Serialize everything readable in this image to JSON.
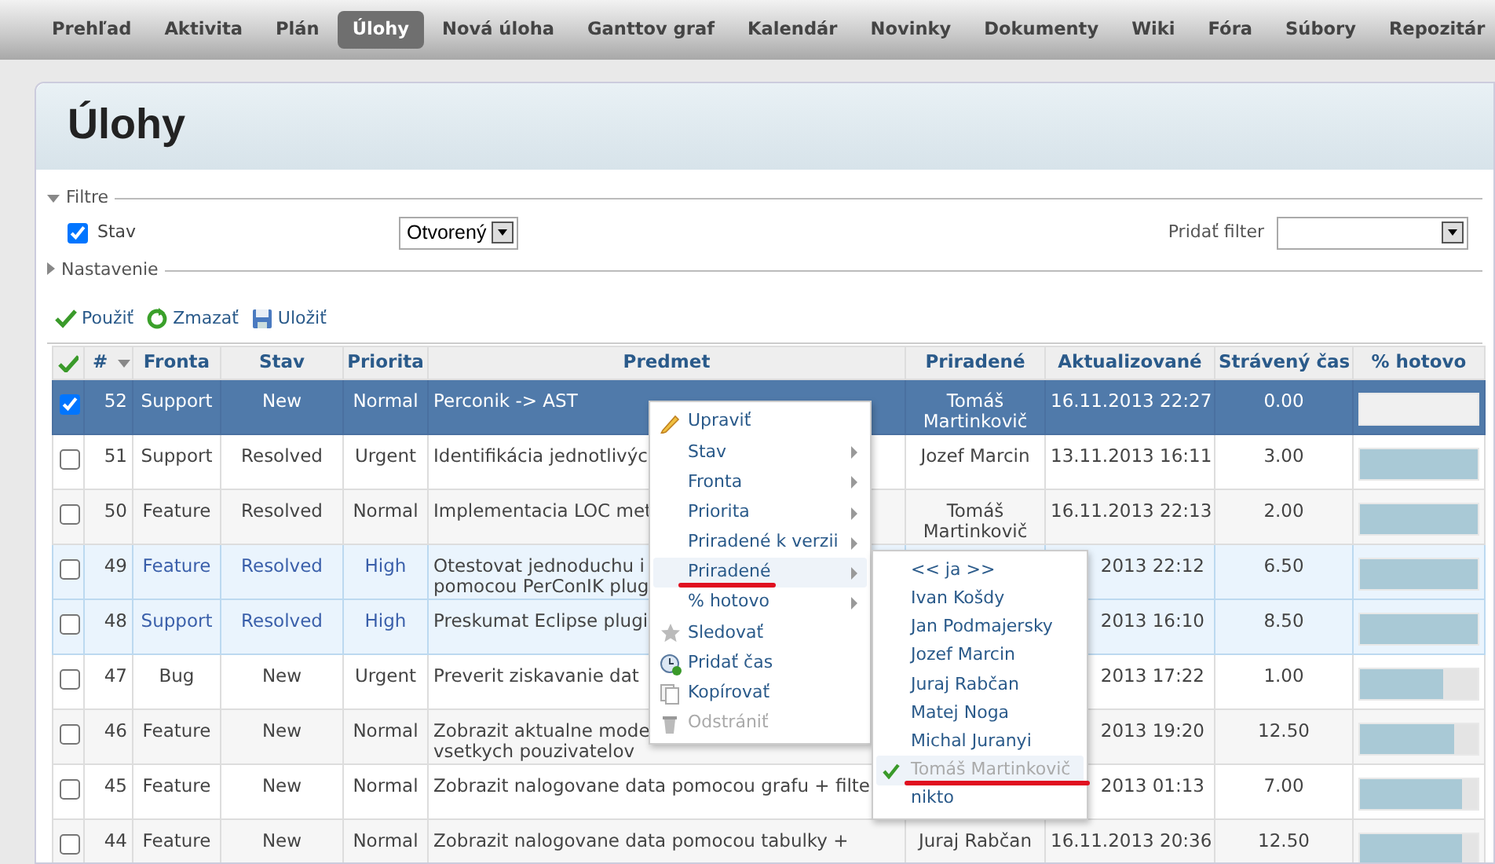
{
  "nav": [
    {
      "label": "Prehľad",
      "selected": false
    },
    {
      "label": "Aktivita",
      "selected": false
    },
    {
      "label": "Plán",
      "selected": false
    },
    {
      "label": "Úlohy",
      "selected": true
    },
    {
      "label": "Nová úloha",
      "selected": false
    },
    {
      "label": "Ganttov graf",
      "selected": false
    },
    {
      "label": "Kalendár",
      "selected": false
    },
    {
      "label": "Novinky",
      "selected": false
    },
    {
      "label": "Dokumenty",
      "selected": false
    },
    {
      "label": "Wiki",
      "selected": false
    },
    {
      "label": "Fóra",
      "selected": false
    },
    {
      "label": "Súbory",
      "selected": false
    },
    {
      "label": "Repozitár",
      "selected": false
    }
  ],
  "page_title": "Úlohy",
  "filters": {
    "legend": "Filtre",
    "expanded": true,
    "field": {
      "label": "Stav",
      "checked": true,
      "value": "Otvorený"
    },
    "add_label": "Pridať filter"
  },
  "options": {
    "legend": "Nastavenie",
    "expanded": false
  },
  "actions": [
    {
      "kind": "apply",
      "label": "Použiť"
    },
    {
      "kind": "clear",
      "label": "Zmazať"
    },
    {
      "kind": "save",
      "label": "Uložiť"
    }
  ],
  "table": {
    "columns": [
      "#",
      "Fronta",
      "Stav",
      "Priorita",
      "Predmet",
      "Priradené",
      "Aktualizované",
      "Strávený čas",
      "% hotovo"
    ],
    "rows": [
      {
        "id": "52",
        "tracker": "Support",
        "status": "New",
        "priority": "Normal",
        "subject": [
          "Perconik -> AST"
        ],
        "assignee": [
          "Tomáš",
          "Martinkovič"
        ],
        "updated": "16.11.2013 22:27",
        "spent": "0.00",
        "level": 0,
        "selected": true,
        "highlighted": false
      },
      {
        "id": "51",
        "tracker": "Support",
        "status": "Resolved",
        "priority": "Urgent",
        "subject": [
          "Identifikácia jednotlivýc"
        ],
        "assignee": [
          "Jozef Marcin"
        ],
        "updated": "13.11.2013 16:11",
        "spent": "3.00",
        "level": 1,
        "selected": false,
        "highlighted": false
      },
      {
        "id": "50",
        "tracker": "Feature",
        "status": "Resolved",
        "priority": "Normal",
        "subject": [
          "Implementacia LOC met"
        ],
        "assignee": [
          "Tomáš",
          "Martinkovič"
        ],
        "updated": "16.11.2013 22:13",
        "spent": "2.00",
        "level": 1,
        "selected": false,
        "highlighted": false
      },
      {
        "id": "49",
        "tracker": "Feature",
        "status": "Resolved",
        "priority": "High",
        "subject": [
          "Otestovat jednoduchu i",
          "pomocou PerConIK plug"
        ],
        "updated": "2013 22:12",
        "spent": "6.50",
        "level": 1,
        "selected": false,
        "highlighted": true
      },
      {
        "id": "48",
        "tracker": "Support",
        "status": "Resolved",
        "priority": "High",
        "subject": [
          "Preskumat Eclipse plugi"
        ],
        "updated": "2013 16:10",
        "spent": "8.50",
        "level": 1,
        "selected": false,
        "highlighted": true
      },
      {
        "id": "47",
        "tracker": "Bug",
        "status": "New",
        "priority": "Urgent",
        "subject": [
          "Preverit ziskavanie dat"
        ],
        "updated": "2013 17:22",
        "spent": "1.00",
        "level": 0.7,
        "selected": false,
        "highlighted": false
      },
      {
        "id": "46",
        "tracker": "Feature",
        "status": "New",
        "priority": "Normal",
        "subject": [
          "Zobrazit aktualne mode",
          "vsetkych pouzivatelov"
        ],
        "updated": "2013 19:20",
        "spent": "12.50",
        "level": 0.8,
        "selected": false,
        "highlighted": false
      },
      {
        "id": "45",
        "tracker": "Feature",
        "status": "New",
        "priority": "Normal",
        "subject": [
          "Zobrazit nalogovane data pomocou grafu + filte"
        ],
        "updated": "2013 01:13",
        "spent": "7.00",
        "level": 0.86,
        "selected": false,
        "highlighted": false
      },
      {
        "id": "44",
        "tracker": "Feature",
        "status": "New",
        "priority": "Normal",
        "subject": [
          "Zobrazit nalogovane data pomocou tabulky +"
        ],
        "assignee": [
          "Juraj Rabčan"
        ],
        "updated": "16.11.2013 20:36",
        "spent": "12.50",
        "level": 0.86,
        "selected": false,
        "highlighted": false
      }
    ]
  },
  "context_menu": [
    {
      "kind": "edit",
      "label": "Upraviť",
      "selected": false,
      "disabled": false,
      "underlined": false
    },
    {
      "kind": "submenu",
      "label": "Stav",
      "selected": false,
      "disabled": false,
      "underlined": false
    },
    {
      "kind": "submenu",
      "label": "Fronta",
      "selected": false,
      "disabled": false,
      "underlined": false
    },
    {
      "kind": "submenu",
      "label": "Priorita",
      "selected": false,
      "disabled": false,
      "underlined": false
    },
    {
      "kind": "submenu",
      "label": "Priradené k verzii",
      "selected": false,
      "disabled": false,
      "underlined": false
    },
    {
      "kind": "submenu",
      "label": "Priradené",
      "selected": true,
      "disabled": false,
      "underlined": true
    },
    {
      "kind": "submenu",
      "label": "% hotovo",
      "selected": false,
      "disabled": false,
      "underlined": false
    },
    {
      "kind": "watch",
      "label": "Sledovať",
      "selected": false,
      "disabled": false,
      "underlined": false
    },
    {
      "kind": "time",
      "label": "Pridať čas",
      "selected": false,
      "disabled": false,
      "underlined": false
    },
    {
      "kind": "copy",
      "label": "Kopírovať",
      "selected": false,
      "disabled": false,
      "underlined": false
    },
    {
      "kind": "delete",
      "label": "Odstrániť",
      "selected": false,
      "disabled": true,
      "underlined": false
    }
  ],
  "submenu": [
    {
      "label": "<< ja >>",
      "checked": false,
      "disabled": false,
      "underlined": false
    },
    {
      "label": "Ivan Košdy",
      "checked": false,
      "disabled": false,
      "underlined": false
    },
    {
      "label": "Jan Podmajersky",
      "checked": false,
      "disabled": false,
      "underlined": false
    },
    {
      "label": "Jozef Marcin",
      "checked": false,
      "disabled": false,
      "underlined": false
    },
    {
      "label": "Juraj Rabčan",
      "checked": false,
      "disabled": false,
      "underlined": false
    },
    {
      "label": "Matej Noga",
      "checked": false,
      "disabled": false,
      "underlined": false
    },
    {
      "label": "Michal Juranyi",
      "checked": false,
      "disabled": false,
      "underlined": false
    },
    {
      "label": "Tomáš Martinkovič",
      "checked": true,
      "disabled": true,
      "underlined": true
    },
    {
      "label": "nikto",
      "checked": false,
      "disabled": false,
      "underlined": false
    }
  ]
}
